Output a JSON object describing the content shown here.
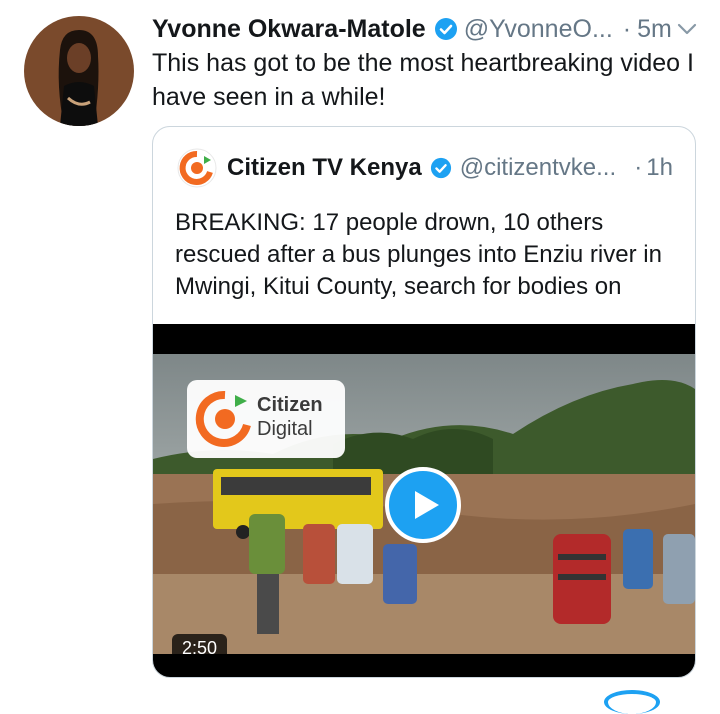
{
  "tweet": {
    "author_name": "Yvonne Okwara-Matole",
    "handle": "@YvonneO...",
    "separator": "·",
    "time": "5m",
    "text": "This has got to be the most heartbreaking video I have seen in a while!"
  },
  "quoted": {
    "author_name": "Citizen TV Kenya",
    "handle": "@citizentvke...",
    "separator": "·",
    "time": "1h",
    "text": "BREAKING: 17 people drown, 10 others rescued after a bus plunges into Enziu river in Mwingi, Kitui County, search for bodies on",
    "video": {
      "watermark_line1": "Citizen",
      "watermark_line2": "Digital",
      "duration": "2:50"
    }
  },
  "colors": {
    "verified": "#1da1f2",
    "secondary_text": "#657786",
    "border": "#ccd6dd"
  },
  "icons": {
    "verified": "verified-badge-icon",
    "chevron": "chevron-down-icon",
    "play": "play-icon"
  }
}
